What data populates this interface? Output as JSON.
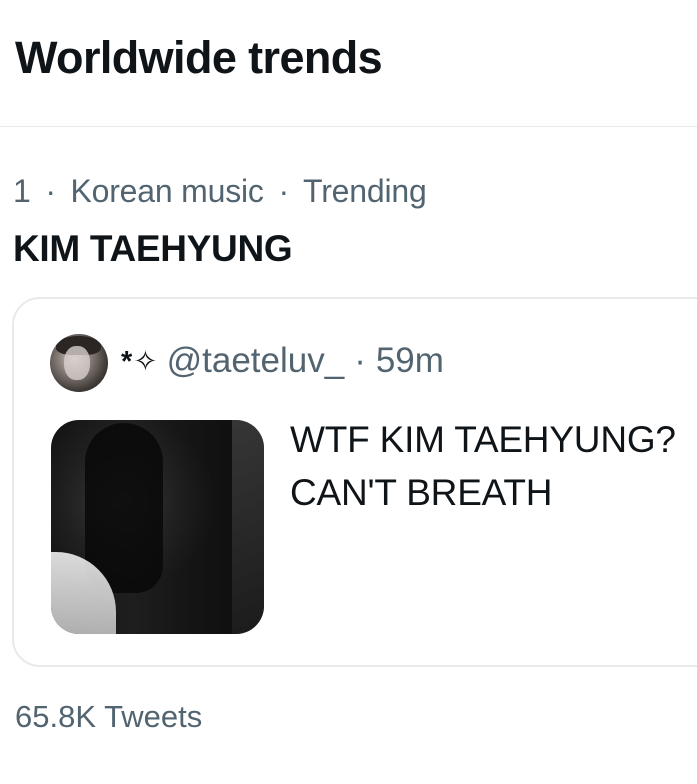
{
  "header": {
    "title": "Worldwide trends"
  },
  "trend": {
    "rank": "1",
    "category": "Korean music",
    "status": "Trending",
    "title": "KIM TAEHYUNG",
    "tweet_count": "65.8K Tweets"
  },
  "tweet": {
    "author_name": "*✧",
    "handle": "@taeteluv_",
    "time": "59m",
    "text": "WTF KIM TAEHYUNG?\nCAN'T BREATH"
  },
  "colors": {
    "text_primary": "#0f1419",
    "text_secondary": "#536471",
    "border": "#e7e9ea"
  }
}
